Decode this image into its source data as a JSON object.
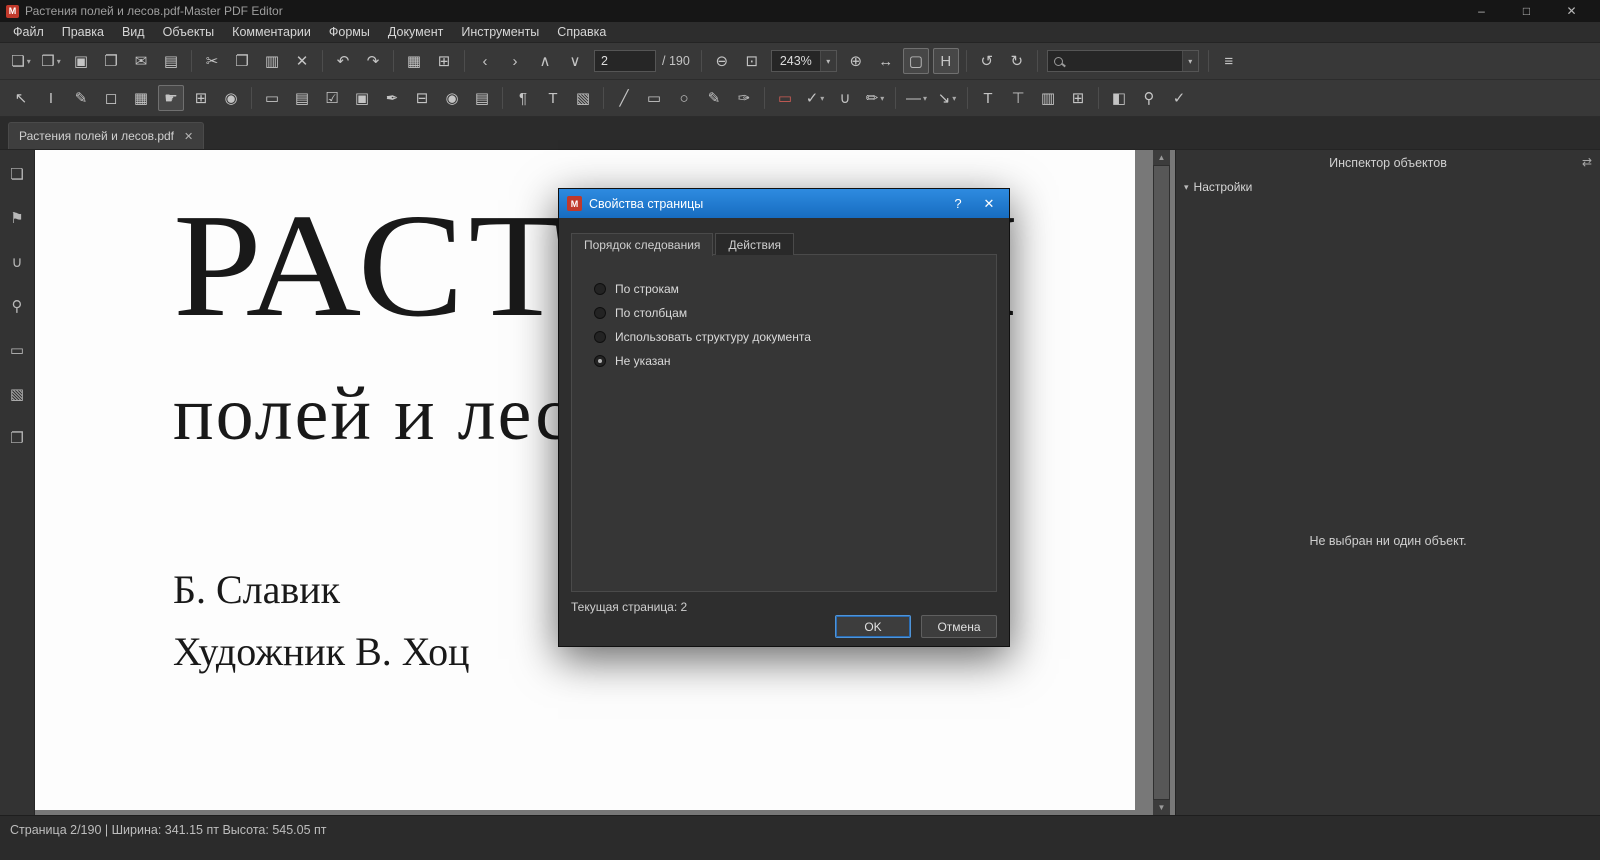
{
  "window": {
    "title": "Растения полей и лесов.pdf-Master PDF Editor",
    "app_logo": "M",
    "minimize": "–",
    "maximize": "□",
    "close": "✕"
  },
  "menubar": {
    "items": [
      {
        "name": "menu-file",
        "label": "Файл"
      },
      {
        "name": "menu-edit",
        "label": "Правка"
      },
      {
        "name": "menu-view",
        "label": "Вид"
      },
      {
        "name": "menu-objects",
        "label": "Объекты"
      },
      {
        "name": "menu-comments",
        "label": "Комментарии"
      },
      {
        "name": "menu-forms",
        "label": "Формы"
      },
      {
        "name": "menu-document",
        "label": "Документ"
      },
      {
        "name": "menu-tools",
        "label": "Инструменты"
      },
      {
        "name": "menu-help",
        "label": "Справка"
      }
    ]
  },
  "toolbar_main": {
    "items_file": [
      {
        "name": "new-document-button",
        "glyph": "❏",
        "caret": "▾"
      },
      {
        "name": "open-document-button",
        "glyph": "❒",
        "caret": "▾"
      },
      {
        "name": "save-button",
        "glyph": "▣"
      },
      {
        "name": "save-as-button",
        "glyph": "❐"
      },
      {
        "name": "email-button",
        "glyph": "✉"
      },
      {
        "name": "print-button",
        "glyph": "▤"
      },
      {
        "name": "toolbar-separator",
        "cls": "sep",
        "inter": "false"
      },
      {
        "name": "cut-button",
        "glyph": "✂"
      },
      {
        "name": "copy-button",
        "glyph": "❐"
      },
      {
        "name": "paste-button",
        "glyph": "▥"
      },
      {
        "name": "delete-button",
        "glyph": "✕"
      },
      {
        "name": "toolbar-separator",
        "cls": "sep",
        "inter": "false"
      },
      {
        "name": "undo-button",
        "glyph": "↶"
      },
      {
        "name": "redo-button",
        "glyph": "↷"
      },
      {
        "name": "toolbar-separator",
        "cls": "sep",
        "inter": "false"
      },
      {
        "name": "show-grid-button",
        "glyph": "▦"
      },
      {
        "name": "snap-to-grid-button",
        "glyph": "⊞"
      },
      {
        "name": "toolbar-separator",
        "cls": "sep",
        "inter": "false"
      },
      {
        "name": "previous-page-button",
        "glyph": "‹"
      },
      {
        "name": "next-page-button",
        "glyph": "›"
      },
      {
        "name": "page-up-button",
        "glyph": "∧"
      },
      {
        "name": "page-down-button",
        "glyph": "∨"
      }
    ],
    "page_input": "2",
    "page_total": "/ 190",
    "items_mid": [
      {
        "name": "toolbar-separator",
        "cls": "sep",
        "inter": "false"
      },
      {
        "name": "zoom-out-button",
        "glyph": "⊖"
      },
      {
        "name": "zoom-marquee-button",
        "glyph": "⊡"
      }
    ],
    "zoom_value": "243%",
    "zoom_caret": "▾",
    "items_view": [
      {
        "name": "zoom-in-button",
        "glyph": "⊕"
      },
      {
        "name": "fit-width-button",
        "glyph": "↔"
      },
      {
        "name": "fit-page-button",
        "glyph": "▢",
        "cls": "active"
      },
      {
        "name": "highlight-fields-button",
        "glyph": "H",
        "cls": "active"
      },
      {
        "name": "toolbar-separator",
        "cls": "sep",
        "inter": "false"
      },
      {
        "name": "rotate-left-button",
        "glyph": "↺"
      },
      {
        "name": "rotate-right-button",
        "glyph": "↻"
      },
      {
        "name": "toolbar-separator",
        "cls": "sep",
        "inter": "false"
      }
    ],
    "search_caret": "▾",
    "items_end": [
      {
        "name": "toolbar-separator",
        "cls": "sep",
        "inter": "false"
      },
      {
        "name": "toolbar-menu-button",
        "glyph": "≡"
      }
    ]
  },
  "toolbar_tools": {
    "items": [
      {
        "name": "select-tool-button",
        "glyph": "↖"
      },
      {
        "name": "text-select-tool-button",
        "glyph": "I"
      },
      {
        "name": "edit-document-tool-button",
        "glyph": "✎"
      },
      {
        "name": "select-object-tool-button",
        "glyph": "◻"
      },
      {
        "name": "edit-forms-tool-button",
        "glyph": "▦"
      },
      {
        "name": "hand-tool-button",
        "glyph": "☛",
        "cls": "active"
      },
      {
        "name": "zoom-tool-button",
        "glyph": "⊞"
      },
      {
        "name": "snapshot-tool-button",
        "glyph": "◉"
      },
      {
        "name": "toolbar-separator",
        "cls": "sep",
        "inter": "false"
      },
      {
        "name": "text-field-button",
        "glyph": "▭"
      },
      {
        "name": "note-annotation-button",
        "glyph": "▤"
      },
      {
        "name": "checkbox-field-button",
        "glyph": "☑"
      },
      {
        "name": "push-button-field-button",
        "glyph": "▣"
      },
      {
        "name": "signature-field-button",
        "glyph": "✒"
      },
      {
        "name": "combobox-field-button",
        "glyph": "⊟"
      },
      {
        "name": "radiobutton-field-button",
        "glyph": "◉"
      },
      {
        "name": "listbox-field-button",
        "glyph": "▤"
      },
      {
        "name": "toolbar-separator",
        "cls": "sep",
        "inter": "false"
      },
      {
        "name": "text-align-button",
        "glyph": "¶"
      },
      {
        "name": "add-text-button",
        "glyph": "T"
      },
      {
        "name": "add-image-button",
        "glyph": "▧"
      },
      {
        "name": "toolbar-separator",
        "cls": "sep",
        "inter": "false"
      },
      {
        "name": "line-tool-button",
        "glyph": "╱"
      },
      {
        "name": "rectangle-tool-button",
        "glyph": "▭"
      },
      {
        "name": "ellipse-tool-button",
        "glyph": "○"
      },
      {
        "name": "pencil-tool-button",
        "glyph": "✎"
      },
      {
        "name": "freehand-sign-button",
        "glyph": "✑"
      },
      {
        "name": "toolbar-separator",
        "cls": "sep",
        "inter": "false"
      },
      {
        "name": "highlight-area-button",
        "glyph": "▭",
        "cls": "red"
      },
      {
        "name": "stamp-tool-button",
        "glyph": "✓",
        "caret": "▾"
      },
      {
        "name": "attach-file-button",
        "glyph": "∪"
      },
      {
        "name": "highlighter-tool-button",
        "glyph": "✏",
        "caret": "▾"
      },
      {
        "name": "toolbar-separator",
        "cls": "sep",
        "inter": "false"
      },
      {
        "name": "line-style-button",
        "glyph": "―",
        "caret": "▾"
      },
      {
        "name": "arrow-style-button",
        "glyph": "↘",
        "caret": "▾"
      },
      {
        "name": "toolbar-separator",
        "cls": "sep",
        "inter": "false"
      },
      {
        "name": "edit-text-button",
        "glyph": "T"
      },
      {
        "name": "text-box-button",
        "glyph": "⊤"
      },
      {
        "name": "insert-page-button",
        "glyph": "▥"
      },
      {
        "name": "page-manager-button",
        "glyph": "⊞"
      },
      {
        "name": "toolbar-separator",
        "cls": "sep",
        "inter": "false"
      },
      {
        "name": "eraser-button",
        "glyph": "◧"
      },
      {
        "name": "loupe-button",
        "glyph": "⚲"
      },
      {
        "name": "spellcheck-button",
        "glyph": "✓"
      }
    ]
  },
  "tabbar": {
    "tab_label": "Растения полей и лесов.pdf",
    "tab_close": "✕"
  },
  "sidebar": {
    "items": [
      {
        "name": "thumbnails-panel-button",
        "glyph": "❏"
      },
      {
        "name": "bookmarks-panel-button",
        "glyph": "⚑"
      },
      {
        "name": "attachments-panel-button",
        "glyph": "∪"
      },
      {
        "name": "search-panel-button",
        "glyph": "⚲"
      },
      {
        "name": "form-fields-panel-button",
        "glyph": "▭"
      },
      {
        "name": "signatures-panel-button",
        "glyph": "▧"
      },
      {
        "name": "layers-panel-button",
        "glyph": "❐"
      }
    ]
  },
  "document": {
    "title_line1": "РАСТЕНИЯ",
    "title_line2": "полей и лесов",
    "author": "Б. Славик",
    "artist": "Художник В. Хоц"
  },
  "scrollbar": {
    "up": "▲",
    "down": "▼"
  },
  "dialog": {
    "logo": "M",
    "title": "Свойства страницы",
    "help": "?",
    "close": "✕",
    "tabs": [
      {
        "name": "tab-page-order",
        "label": "Порядок следования",
        "cls": "active"
      },
      {
        "name": "tab-actions",
        "label": "Действия"
      }
    ],
    "options": [
      {
        "name": "radio-by-rows",
        "label": "По строкам"
      },
      {
        "name": "radio-by-columns",
        "label": "По столбцам"
      },
      {
        "name": "radio-document-structure",
        "label": "Использовать структуру документа"
      },
      {
        "name": "radio-not-specified",
        "label": "Не указан",
        "cls": "selected"
      }
    ],
    "current_page_label": "Текущая страница: 2",
    "ok_label": "OK",
    "cancel_label": "Отмена"
  },
  "inspector": {
    "title": "Инспектор объектов",
    "dock_icon": "⇄",
    "triangle": "▾",
    "section": "Настройки",
    "empty_message": "Не выбран ни один объект."
  },
  "statusbar": {
    "text": "Страница 2/190 | Ширина: 341.15 пт Высота: 545.05 пт"
  }
}
